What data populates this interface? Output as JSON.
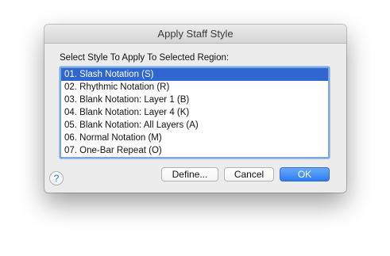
{
  "window": {
    "title": "Apply Staff Style"
  },
  "prompt": "Select Style To Apply To Selected Region:",
  "styles": {
    "items": [
      {
        "label": "01.  Slash Notation (S)",
        "selected": true
      },
      {
        "label": "02.  Rhythmic Notation (R)",
        "selected": false
      },
      {
        "label": "03.  Blank Notation:  Layer 1 (B)",
        "selected": false
      },
      {
        "label": "04.  Blank Notation:  Layer 4 (K)",
        "selected": false
      },
      {
        "label": "05.  Blank Notation:  All Layers (A)",
        "selected": false
      },
      {
        "label": "06.  Normal Notation (M)",
        "selected": false
      },
      {
        "label": "07.  One-Bar Repeat (O)",
        "selected": false
      }
    ]
  },
  "buttons": {
    "help": "?",
    "define": "Define...",
    "cancel": "Cancel",
    "ok": "OK"
  },
  "colors": {
    "selection": "#2f66cf",
    "default_button": "#2c7df2",
    "focus_ring": "#7aa7df"
  }
}
